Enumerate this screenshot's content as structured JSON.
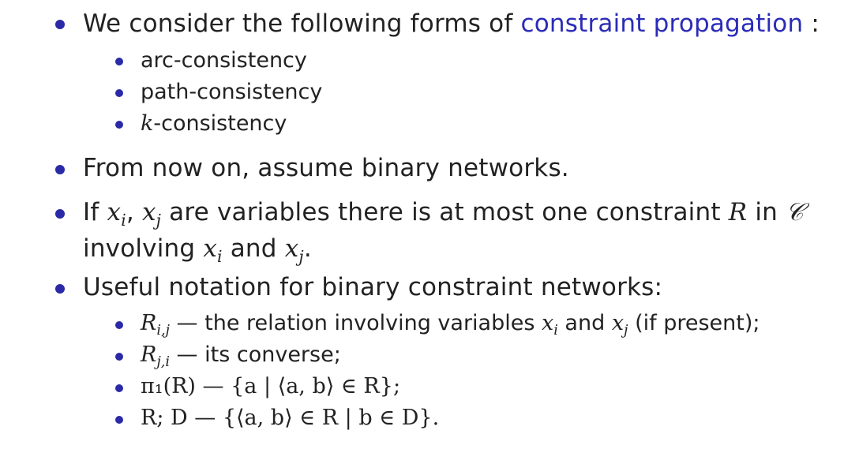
{
  "items": {
    "i1_prefix": "We consider the following forms of ",
    "i1_link": "constraint propagation",
    "i1_suffix": " :",
    "sub1": [
      "arc-consistency",
      "path-consistency",
      "-consistency"
    ],
    "sub1_k": "k",
    "i2": "From now on, assume binary networks.",
    "i3_line1_a": "If ",
    "i3_line1_b": " are variables there is at most one constraint ",
    "i3_line1_c": " in ",
    "i3_line2_a": "involving ",
    "i3_line2_b": " and ",
    "i3_line2_c": ".",
    "i4": "Useful notation for binary constraint networks:",
    "n1_text": " — the relation involving variables ",
    "n1_and": " and ",
    "n1_tail": " (if present);",
    "n2_text": " — its converse;",
    "n3_text": "π₁(R) — {a | ⟨a, b⟩ ∈ R};",
    "n4_text": "R; D — {⟨a, b⟩ ∈ R | b ∈ D}."
  },
  "colors": {
    "bullet": "#2a2aa8",
    "link": "#2b2bb8",
    "text": "#222222"
  }
}
